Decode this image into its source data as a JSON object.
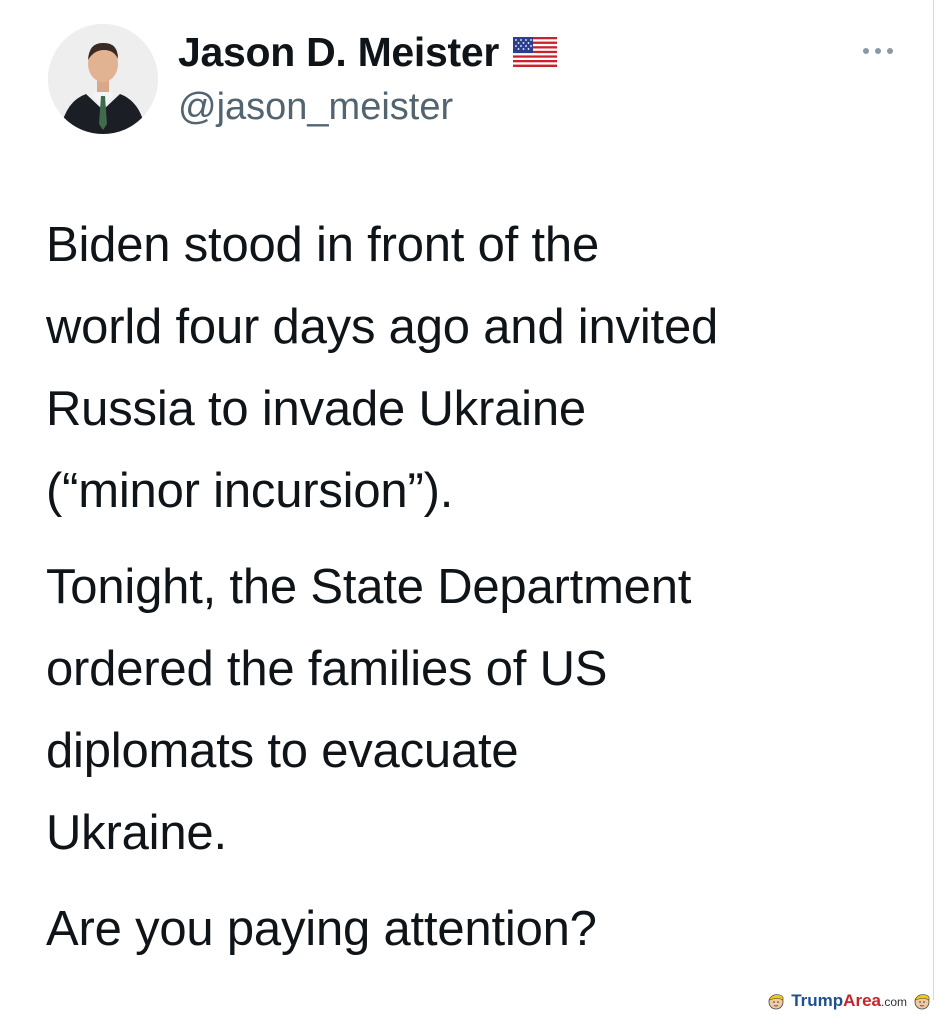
{
  "tweet": {
    "author": {
      "display_name": "Jason D. Meister",
      "handle": "@jason_meister",
      "badge_icon": "us-flag-icon",
      "avatar_icon": "profile-photo"
    },
    "menu_icon": "more-horizontal-icon",
    "paragraphs": [
      "Biden stood in front of the\nworld four days ago and invited\nRussia to invade Ukraine\n(“minor incursion”).",
      "Tonight, the State Department\nordered the families of US\ndiplomats to evacuate\nUkraine.",
      "Are you paying attention?"
    ]
  },
  "watermark": {
    "brand_primary": "Trump",
    "brand_accent": "Area",
    "brand_suffix": ".com",
    "icon": "trump-face-icon"
  },
  "colors": {
    "text": "#0f1419",
    "secondary_text": "#536471",
    "watermark_blue": "#1d4f91",
    "watermark_red": "#c8232b"
  }
}
